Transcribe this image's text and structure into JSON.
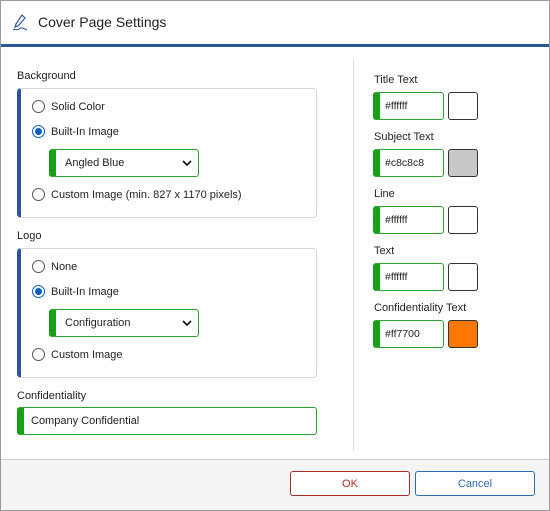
{
  "window": {
    "title": "Cover Page Settings",
    "icon": "signature-pen-icon"
  },
  "background": {
    "label": "Background",
    "options": [
      {
        "label": "Solid Color",
        "checked": false
      },
      {
        "label": "Built-In Image",
        "checked": true
      },
      {
        "label": "Custom Image (min. 827 x 1170 pixels)",
        "checked": false
      }
    ],
    "builtin_select": "Angled Blue"
  },
  "logo": {
    "label": "Logo",
    "options": [
      {
        "label": "None",
        "checked": false
      },
      {
        "label": "Built-In Image",
        "checked": true
      },
      {
        "label": "Custom Image",
        "checked": false
      }
    ],
    "builtin_select": "Configuration"
  },
  "confidentiality": {
    "label": "Confidentiality",
    "value": "Company Confidential"
  },
  "colors": [
    {
      "label": "Title Text",
      "value": "#ffffff",
      "swatch": "#ffffff"
    },
    {
      "label": "Subject Text",
      "value": "#c8c8c8",
      "swatch": "#c8c8c8"
    },
    {
      "label": "Line",
      "value": "#ffffff",
      "swatch": "#ffffff"
    },
    {
      "label": "Text",
      "value": "#ffffff",
      "swatch": "#ffffff"
    },
    {
      "label": "Confidentiality Text",
      "value": "#ff7700",
      "swatch": "#ff7700"
    }
  ],
  "buttons": {
    "ok": "OK",
    "cancel": "Cancel"
  },
  "theme": {
    "accent": "#2b5797",
    "input_accent": "#19a019",
    "ok_color": "#b02a2a",
    "cancel_color": "#2b6cb0"
  }
}
